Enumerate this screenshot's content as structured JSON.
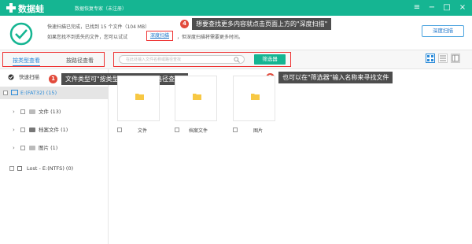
{
  "colors": {
    "brand": "#15b592",
    "alert": "#e24a3b",
    "link": "#1a73c9",
    "tip_bg": "#4d4d4d",
    "folder": "#f7c844"
  },
  "titlebar": {
    "app_name": "数据蛙",
    "subtitle": "数据恢复专家（未注册）",
    "buttons": [
      "menu-icon",
      "minimize-icon",
      "maximize-icon",
      "close-icon"
    ]
  },
  "status": {
    "line1": "快速扫描已完成，已找到 15 个文件（104 MB）",
    "line2_prefix": "如果您找不到丢失的文件，您可以试试",
    "deep_scan_link": "深度扫描",
    "line2_suffix": "，但深度扫描将需要更多时间。",
    "deep_scan_button": "深度扫描"
  },
  "callouts": [
    {
      "num": "4",
      "text": "想要查找更多内容就点击页面上方的\"深度扫描\""
    },
    {
      "num": "1",
      "text": "文件类型可\"按类型查看\"或者\"按路径查看\""
    },
    {
      "num": "2",
      "text": "也可以在\"筛选器\"输入名称来寻找文件"
    }
  ],
  "tabs": {
    "by_type": "按类型查看",
    "by_path": "按路径查看"
  },
  "search": {
    "placeholder": "在此处输入文件名称或路径查找"
  },
  "filter_button": "筛选器",
  "view_modes": [
    "grid-view-icon",
    "list-view-icon",
    "detail-view-icon"
  ],
  "sidebar": {
    "quick_scan": "快速扫描",
    "drive": "E:(FAT32) (15)",
    "items": [
      {
        "label": "文件 (13)"
      },
      {
        "label": "档案文件 (1)"
      },
      {
        "label": "图片 (1)"
      }
    ],
    "lost": "Lost - E:(NTFS) (0)"
  },
  "tiles": [
    {
      "label": "文件"
    },
    {
      "label": "档案文件"
    },
    {
      "label": "图片"
    }
  ]
}
